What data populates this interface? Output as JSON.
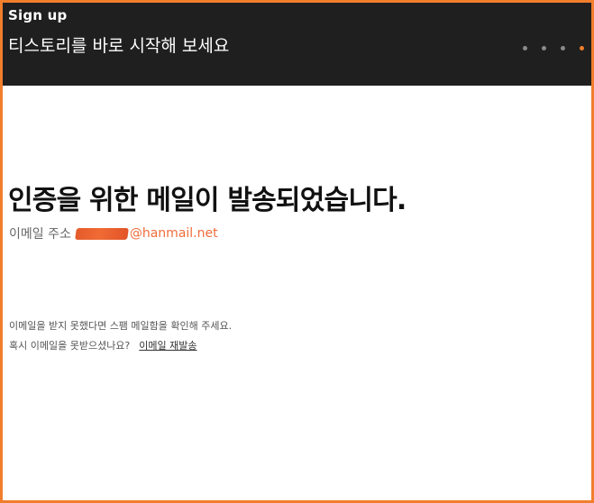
{
  "header": {
    "title": "Sign up",
    "subtitle": "티스토리를 바로 시작해 보세요",
    "steps": [
      {
        "state": "inactive"
      },
      {
        "state": "inactive"
      },
      {
        "state": "inactive"
      },
      {
        "state": "active"
      }
    ],
    "accent_color": "#f07e2c"
  },
  "main": {
    "heading": "인증을 위한 메일이 발송되었습니다.",
    "email_label": "이메일 주소",
    "email_domain": "@hanmail.net",
    "help_text": "이메일을 받지 못했다면 스팸 메일함을 확인해 주세요.",
    "resend_prompt": "혹시 이메일을 못받으셨나요?",
    "resend_link": "이메일 재발송"
  }
}
